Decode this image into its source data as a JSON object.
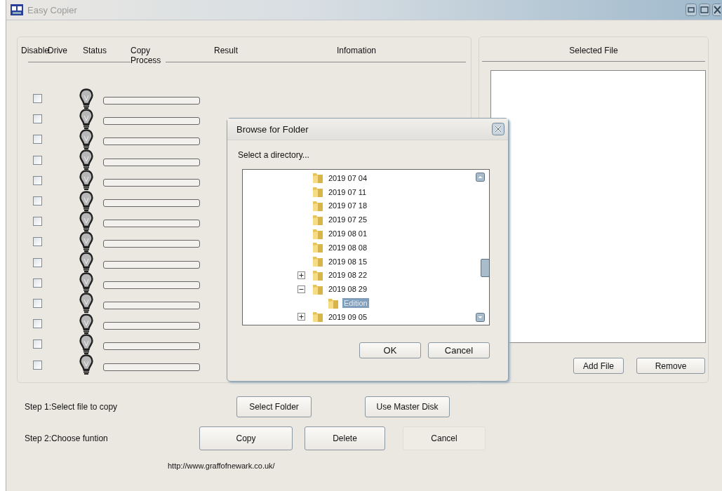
{
  "window": {
    "title": "Easy Copier"
  },
  "drives_panel": {
    "columns": [
      "Disable",
      "Drive",
      "Status",
      "Copy Process",
      "Result",
      "Infomation"
    ],
    "rows": [
      {
        "checked": false
      },
      {
        "checked": false
      },
      {
        "checked": false
      },
      {
        "checked": false
      },
      {
        "checked": false
      },
      {
        "checked": false
      },
      {
        "checked": false
      },
      {
        "checked": false
      },
      {
        "checked": false
      },
      {
        "checked": false
      },
      {
        "checked": false
      },
      {
        "checked": false
      },
      {
        "checked": false
      },
      {
        "checked": false
      }
    ]
  },
  "selected_file_panel": {
    "title": "Selected File",
    "buttons": [
      "Add File",
      "Remove"
    ]
  },
  "steps": [
    {
      "label": "Step 1:Select file to copy",
      "buttons": [
        {
          "label": "Select Folder",
          "disabled": false
        },
        {
          "label": "Use Master Disk",
          "disabled": false
        }
      ]
    },
    {
      "label": "Step 2:Choose funtion",
      "buttons": [
        {
          "label": "Copy",
          "disabled": false
        },
        {
          "label": "Delete",
          "disabled": false
        },
        {
          "label": "Cancel",
          "disabled": true
        }
      ]
    }
  ],
  "link": "http://www.graffofnewark.co.uk/",
  "dialog": {
    "title": "Browse for Folder",
    "prompt": "Select  a  directory...",
    "tree": [
      {
        "label": "2019 07 04",
        "kind": "leaf",
        "selected": false
      },
      {
        "label": "2019 07 11",
        "kind": "leaf",
        "selected": false
      },
      {
        "label": "2019 07 18",
        "kind": "leaf",
        "selected": false
      },
      {
        "label": "2019 07 25",
        "kind": "leaf",
        "selected": false
      },
      {
        "label": "2019 08 01",
        "kind": "leaf",
        "selected": false
      },
      {
        "label": "2019 08 08",
        "kind": "leaf",
        "selected": false
      },
      {
        "label": "2019 08 15",
        "kind": "leaf",
        "selected": false
      },
      {
        "label": "2019 08 22",
        "kind": "branch",
        "expanded": false,
        "selected": false
      },
      {
        "label": "2019 08 29",
        "kind": "branch",
        "expanded": true,
        "selected": false,
        "children": [
          {
            "label": "Edition",
            "kind": "leaf",
            "selected": true
          }
        ]
      },
      {
        "label": "2019 09 05",
        "kind": "branch",
        "expanded": false,
        "selected": false
      }
    ],
    "buttons": [
      "OK",
      "Cancel"
    ]
  }
}
